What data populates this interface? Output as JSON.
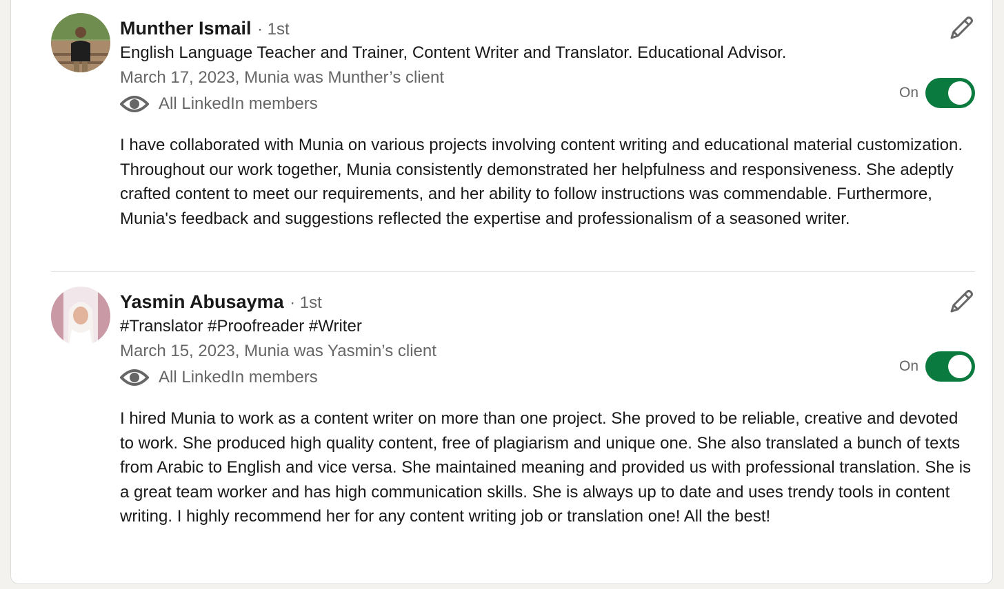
{
  "recommendations": [
    {
      "name": "Munther Ismail",
      "degree": "· 1st",
      "headline": "English Language Teacher and Trainer, Content Writer and Translator. Educational Advisor.",
      "date_relation": "March 17, 2023, Munia was Munther’s client",
      "visibility": "All LinkedIn members",
      "toggle_label": "On",
      "toggle_on": true,
      "text": "I have collaborated with Munia on various projects involving content writing and educational material customization. Throughout our work together, Munia consistently demonstrated her helpfulness and responsiveness. She adeptly crafted content to meet our requirements, and her ability to follow instructions was commendable. Furthermore, Munia's feedback and suggestions reflected the expertise and professionalism of a seasoned writer."
    },
    {
      "name": "Yasmin Abusayma",
      "degree": "· 1st",
      "headline": "#Translator #Proofreader #Writer",
      "date_relation": "March 15, 2023, Munia was Yasmin’s client",
      "visibility": "All LinkedIn members",
      "toggle_label": "On",
      "toggle_on": true,
      "text": "I hired Munia to work as a content writer on more than one project. She proved to be reliable, creative and devoted to work. She produced high quality content, free of plagiarism and unique one. She also translated a bunch of texts from Arabic to English and vice versa. She maintained meaning and provided us with professional translation. She is a great team worker and has high communication skills. She is always up to date and uses trendy tools in content writing. I highly recommend her for any content writing job or translation one! All the best!"
    }
  ],
  "colors": {
    "toggle_on": "#0b7a3e",
    "muted_text": "#666666",
    "primary_text": "#191919"
  },
  "icons": [
    "eye-icon",
    "pencil-icon"
  ]
}
